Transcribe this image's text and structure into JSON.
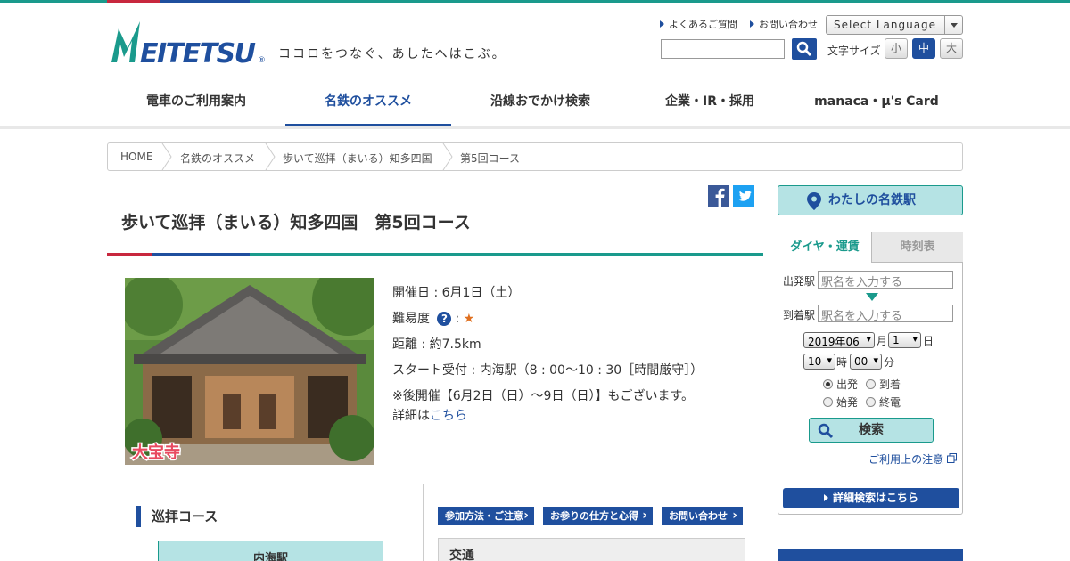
{
  "header": {
    "logo_text": "MEITETSU",
    "tagline": "ココロをつなぐ、あしたへはこぶ。",
    "util_links": [
      "よくあるご質問",
      "お問い合わせ"
    ],
    "language_select": "Select Language",
    "font_size_label": "文字サイズ",
    "font_sizes": [
      "小",
      "中",
      "大"
    ]
  },
  "nav": [
    "電車のご利用案内",
    "名鉄のオススメ",
    "沿線おでかけ検索",
    "企業・IR・採用",
    "manaca・μ's Card"
  ],
  "breadcrumb": [
    "HOME",
    "名鉄のオススメ",
    "歩いて巡拝（まいる）知多四国",
    "第5回コース"
  ],
  "page": {
    "title": "歩いて巡拝（まいる）知多四国　第5回コース",
    "photo_label": "大宝寺",
    "date": "開催日 : 6月1日（土）",
    "difficulty_label": "難易度",
    "difficulty_stars": "★",
    "distance": "距離 : 約7.5km",
    "start": "スタート受付 : 内海駅（8 : 00～10 : 30［時間厳守］）",
    "note": "※後開催【6月2日（日）～9日（日）】もございます。",
    "detail_prefix": "詳細は",
    "detail_link": "こちら",
    "course_heading": "巡拝コース",
    "course_first": "内海駅",
    "tab_buttons": [
      "参加方法・ご注意",
      "お参りの仕方と心得",
      "お問い合わせ"
    ],
    "transport_heading": "交通"
  },
  "sidebar": {
    "my_station": "わたしの名鉄駅",
    "tabs": [
      "ダイヤ・運賃",
      "時刻表"
    ],
    "from_label": "出発駅",
    "to_label": "到着駅",
    "station_placeholder": "駅名を入力する",
    "year_month": "2019年06",
    "month_unit": "月",
    "day": "1",
    "day_unit": "日",
    "hour": "10",
    "hour_unit": "時",
    "minute": "00",
    "minute_unit": "分",
    "radios": [
      "出発",
      "到着",
      "始発",
      "終電"
    ],
    "search_button": "検索",
    "caution_link": "ご利用上の注意",
    "detail_search": "詳細検索はこちら"
  },
  "colors": {
    "brand_blue": "#1f4f9e",
    "teal": "#1a9a8c",
    "red": "#c8283e",
    "light_teal": "#b5e3e4"
  }
}
